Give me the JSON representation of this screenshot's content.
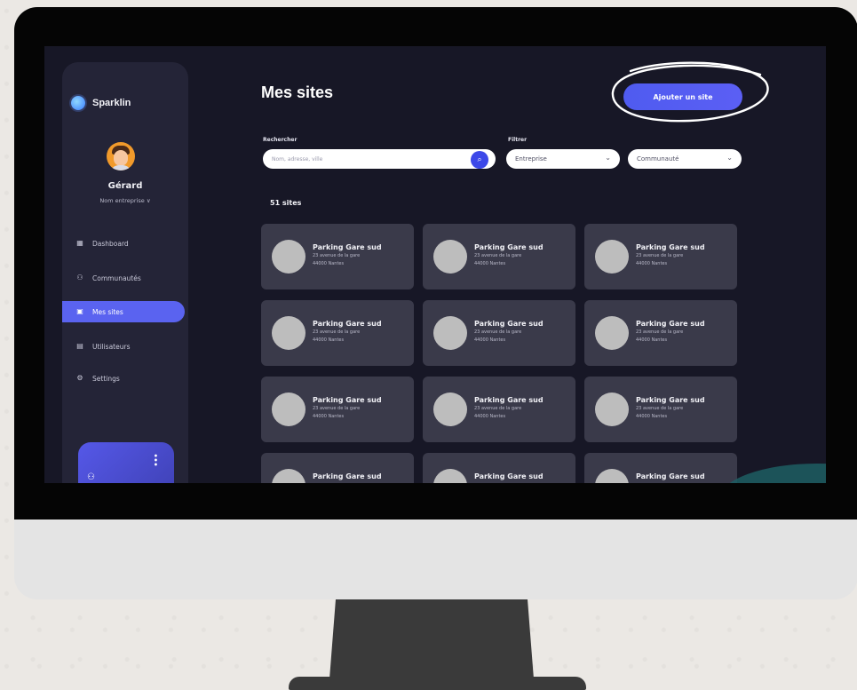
{
  "brand": {
    "name": "Sparklin"
  },
  "user": {
    "name": "Gérard",
    "company": "Nom entreprise ∨"
  },
  "nav": [
    {
      "label": "Dashboard",
      "icon": "dashboard-icon",
      "glyph": "▦"
    },
    {
      "label": "Communautés",
      "icon": "users-icon",
      "glyph": "⚇"
    },
    {
      "label": "Mes sites",
      "icon": "sites-icon",
      "glyph": "▣"
    },
    {
      "label": "Utilisateurs",
      "icon": "calendar-icon",
      "glyph": "▤"
    },
    {
      "label": "Settings",
      "icon": "gear-icon",
      "glyph": "⚙"
    }
  ],
  "header": {
    "title": "Mes sites",
    "add_label": "Ajouter un site"
  },
  "filters": {
    "search_label": "Rechercher",
    "search_placeholder": "Nom, adresse, ville",
    "filter_label": "Filtrer",
    "select_company": "Entreprise",
    "select_community": "Communauté"
  },
  "count": "51 sites",
  "cards": [
    {
      "title": "Parking Gare sud",
      "address": "23 avenue de la gare",
      "city": "44000 Nantes"
    },
    {
      "title": "Parking Gare sud",
      "address": "23 avenue de la gare",
      "city": "44000 Nantes"
    },
    {
      "title": "Parking Gare sud",
      "address": "23 avenue de la gare",
      "city": "44000 Nantes"
    },
    {
      "title": "Parking Gare sud",
      "address": "23 avenue de la gare",
      "city": "44000 Nantes"
    },
    {
      "title": "Parking Gare sud",
      "address": "23 avenue de la gare",
      "city": "44000 Nantes"
    },
    {
      "title": "Parking Gare sud",
      "address": "23 avenue de la gare",
      "city": "44000 Nantes"
    },
    {
      "title": "Parking Gare sud",
      "address": "23 avenue de la gare",
      "city": "44000 Nantes"
    },
    {
      "title": "Parking Gare sud",
      "address": "23 avenue de la gare",
      "city": "44000 Nantes"
    },
    {
      "title": "Parking Gare sud",
      "address": "23 avenue de la gare",
      "city": "44000 Nantes"
    },
    {
      "title": "Parking Gare sud",
      "address": "",
      "city": ""
    },
    {
      "title": "Parking Gare sud",
      "address": "",
      "city": ""
    },
    {
      "title": "Parking Gare sud",
      "address": "",
      "city": ""
    }
  ],
  "colors": {
    "accent": "#5a63f0",
    "background": "#171726",
    "sidebar": "#242437",
    "card": "#3a3a4a"
  }
}
